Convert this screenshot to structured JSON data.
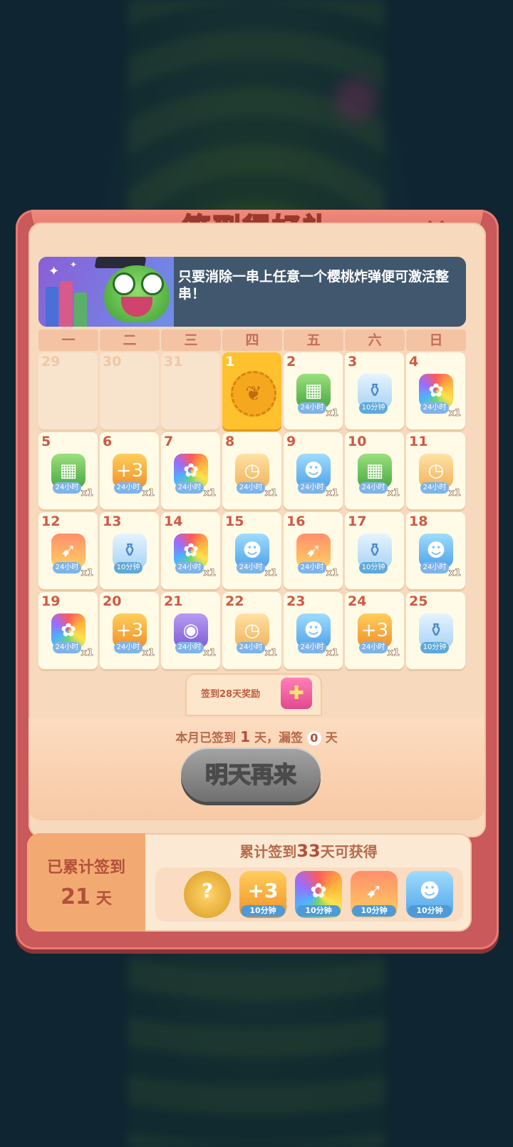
{
  "modal": {
    "title": "签到得好礼",
    "close_icon": "×",
    "tip": "只要消除一串上任意一个樱桃炸弹便可激活整串！"
  },
  "weekdays": [
    "一",
    "二",
    "三",
    "四",
    "五",
    "六",
    "日"
  ],
  "days": [
    {
      "day": "29",
      "state": "past",
      "reward": "",
      "badge": "",
      "count": ""
    },
    {
      "day": "30",
      "state": "past",
      "reward": "",
      "badge": "",
      "count": ""
    },
    {
      "day": "31",
      "state": "past",
      "reward": "",
      "badge": "",
      "count": ""
    },
    {
      "day": "1",
      "state": "today",
      "reward": "paw-stamp",
      "badge": "",
      "count": ""
    },
    {
      "day": "2",
      "state": "future",
      "reward": "chest",
      "badge": "24小时",
      "count": "x1"
    },
    {
      "day": "3",
      "state": "future",
      "reward": "bottle",
      "badge": "10分钟",
      "count": ""
    },
    {
      "day": "4",
      "state": "future",
      "reward": "rainbow",
      "badge": "24小时",
      "count": "x1"
    },
    {
      "day": "5",
      "state": "future",
      "reward": "chest",
      "badge": "24小时",
      "count": "x1"
    },
    {
      "day": "6",
      "state": "future",
      "reward": "plus3",
      "badge": "24小时",
      "count": "x1"
    },
    {
      "day": "7",
      "state": "future",
      "reward": "rainbow",
      "badge": "24小时",
      "count": "x1"
    },
    {
      "day": "8",
      "state": "future",
      "reward": "clock",
      "badge": "24小时",
      "count": "x1"
    },
    {
      "day": "9",
      "state": "future",
      "reward": "cat",
      "badge": "24小时",
      "count": "x1"
    },
    {
      "day": "10",
      "state": "future",
      "reward": "chest",
      "badge": "24小时",
      "count": "x1"
    },
    {
      "day": "11",
      "state": "future",
      "reward": "clock",
      "badge": "24小时",
      "count": "x1"
    },
    {
      "day": "12",
      "state": "future",
      "reward": "rocket",
      "badge": "24小时",
      "count": "x1"
    },
    {
      "day": "13",
      "state": "future",
      "reward": "bottle",
      "badge": "10分钟",
      "count": ""
    },
    {
      "day": "14",
      "state": "future",
      "reward": "rainbow",
      "badge": "24小时",
      "count": "x1"
    },
    {
      "day": "15",
      "state": "future",
      "reward": "cat",
      "badge": "24小时",
      "count": "x1"
    },
    {
      "day": "16",
      "state": "future",
      "reward": "rocket",
      "badge": "24小时",
      "count": "x1"
    },
    {
      "day": "17",
      "state": "future",
      "reward": "bottle",
      "badge": "10分钟",
      "count": ""
    },
    {
      "day": "18",
      "state": "future",
      "reward": "cat",
      "badge": "24小时",
      "count": "x1"
    },
    {
      "day": "19",
      "state": "future",
      "reward": "rainbow",
      "badge": "24小时",
      "count": "x1"
    },
    {
      "day": "20",
      "state": "future",
      "reward": "plus3",
      "badge": "24小时",
      "count": "x1"
    },
    {
      "day": "21",
      "state": "future",
      "reward": "owl",
      "badge": "24小时",
      "count": "x1"
    },
    {
      "day": "22",
      "state": "future",
      "reward": "clock",
      "badge": "24小时",
      "count": "x1"
    },
    {
      "day": "23",
      "state": "future",
      "reward": "cat",
      "badge": "24小时",
      "count": "x1"
    },
    {
      "day": "24",
      "state": "future",
      "reward": "plus3",
      "badge": "24小时",
      "count": "x1"
    },
    {
      "day": "25",
      "state": "future",
      "reward": "bottle",
      "badge": "10分钟",
      "count": ""
    }
  ],
  "bonus": {
    "label": "签到28天奖励",
    "icon": "gift-icon"
  },
  "stats": {
    "prefix": "本月已签到",
    "signed": "1",
    "mid": "天，漏签",
    "missed": "0",
    "suffix": "天"
  },
  "button": {
    "label": "明天再来"
  },
  "cumulative": {
    "label": "已累计签到",
    "days": "21",
    "unit": "天",
    "head_prefix": "累计签到",
    "target": "33",
    "head_suffix": "天可获得",
    "rewards": [
      {
        "icon": "mystery-medal",
        "tag": ""
      },
      {
        "icon": "plus3",
        "tag": "10分钟"
      },
      {
        "icon": "rainbow",
        "tag": "10分钟"
      },
      {
        "icon": "rocket",
        "tag": "10分钟"
      },
      {
        "icon": "cat",
        "tag": "10分钟"
      }
    ]
  }
}
